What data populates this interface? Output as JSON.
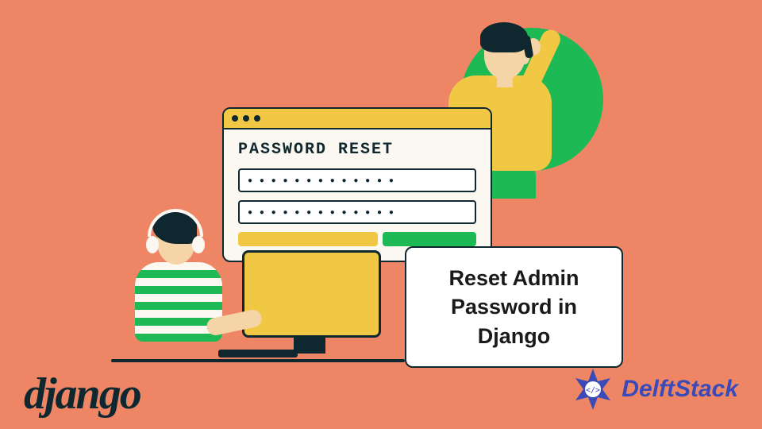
{
  "password_window": {
    "heading": "PASSWORD RESET",
    "field1_mask": "● ● ● ● ● ● ● ● ● ● ● ● ●",
    "field2_mask": "● ● ● ● ● ● ● ● ● ● ● ● ●"
  },
  "title_card": {
    "text": "Reset Admin Password in Django"
  },
  "logos": {
    "django": "django",
    "delftstack": "DelftStack"
  },
  "colors": {
    "background": "#ee8666",
    "green": "#1db954",
    "yellow": "#f0c843",
    "dark": "#0f2830",
    "cream": "#faf8f0",
    "blue": "#3a4bb8"
  }
}
